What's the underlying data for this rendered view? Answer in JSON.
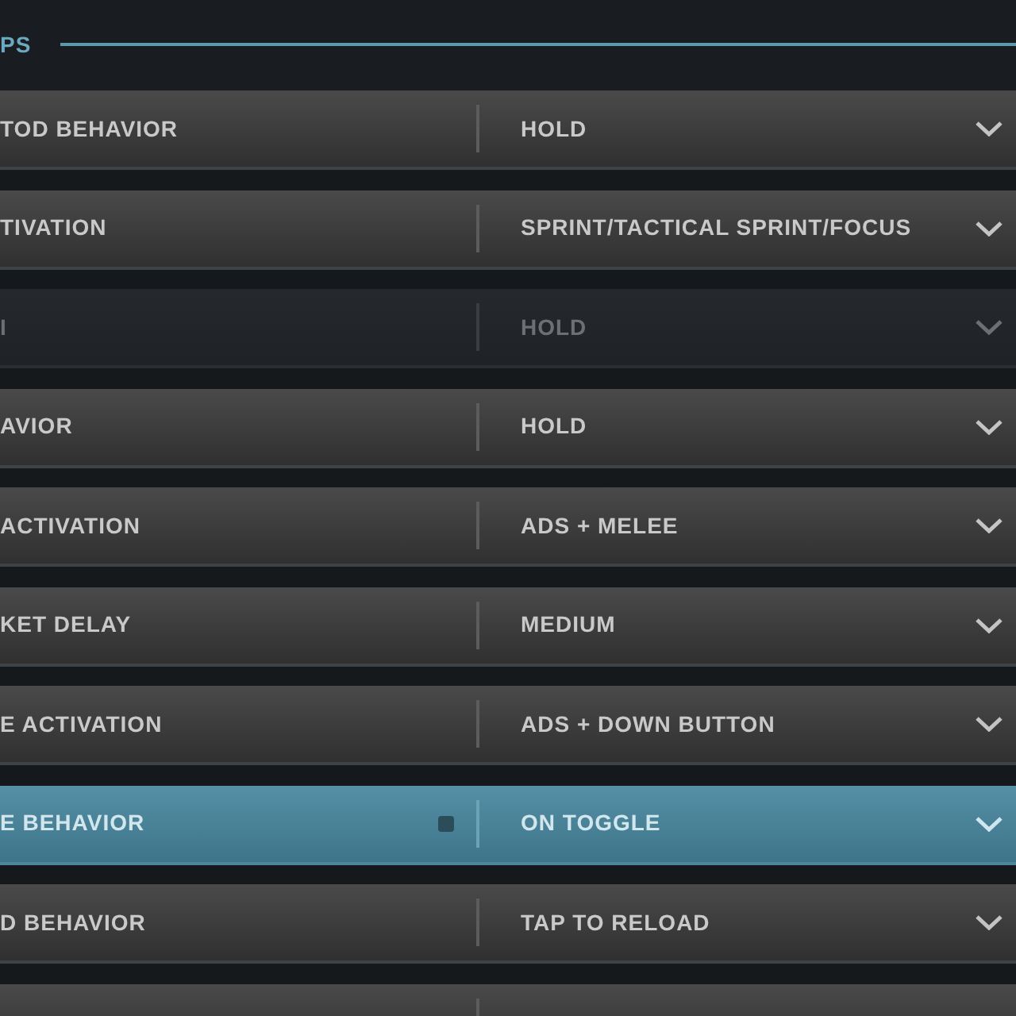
{
  "section": {
    "title": "PS"
  },
  "rows": [
    {
      "label": "TOD BEHAVIOR",
      "value": "HOLD",
      "selected": false,
      "disabled": false
    },
    {
      "label": "TIVATION",
      "value": "SPRINT/TACTICAL SPRINT/FOCUS",
      "selected": false,
      "disabled": false
    },
    {
      "label": "I",
      "value": "HOLD",
      "selected": false,
      "disabled": true
    },
    {
      "label": "AVIOR",
      "value": "HOLD",
      "selected": false,
      "disabled": false
    },
    {
      "label": "ACTIVATION",
      "value": "ADS + MELEE",
      "selected": false,
      "disabled": false
    },
    {
      "label": "KET DELAY",
      "value": "MEDIUM",
      "selected": false,
      "disabled": false
    },
    {
      "label": "E ACTIVATION",
      "value": "ADS + DOWN BUTTON",
      "selected": false,
      "disabled": false
    },
    {
      "label": "E BEHAVIOR",
      "value": "ON TOGGLE",
      "selected": true,
      "disabled": false,
      "marker": true
    },
    {
      "label": "D BEHAVIOR",
      "value": "TAP TO RELOAD",
      "selected": false,
      "disabled": false
    },
    {
      "selected": false,
      "disabled": false
    }
  ]
}
